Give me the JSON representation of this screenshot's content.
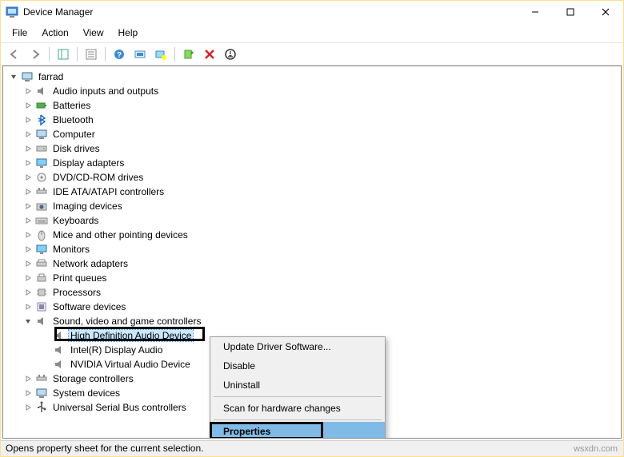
{
  "window": {
    "title": "Device Manager"
  },
  "menubar": {
    "file": "File",
    "action": "Action",
    "view": "View",
    "help": "Help"
  },
  "tree": {
    "root": "farrad",
    "nodes": [
      "Audio inputs and outputs",
      "Batteries",
      "Bluetooth",
      "Computer",
      "Disk drives",
      "Display adapters",
      "DVD/CD-ROM drives",
      "IDE ATA/ATAPI controllers",
      "Imaging devices",
      "Keyboards",
      "Mice and other pointing devices",
      "Monitors",
      "Network adapters",
      "Print queues",
      "Processors",
      "Software devices",
      "Sound, video and game controllers",
      "Storage controllers",
      "System devices",
      "Universal Serial Bus controllers"
    ],
    "sound_children": [
      "High Definition Audio Device",
      "Intel(R) Display Audio",
      "NVIDIA Virtual Audio Device"
    ]
  },
  "context_menu": {
    "update": "Update Driver Software...",
    "disable": "Disable",
    "uninstall": "Uninstall",
    "scan": "Scan for hardware changes",
    "properties": "Properties"
  },
  "statusbar": {
    "text": "Opens property sheet for the current selection."
  },
  "watermark": "wsxdn.com"
}
